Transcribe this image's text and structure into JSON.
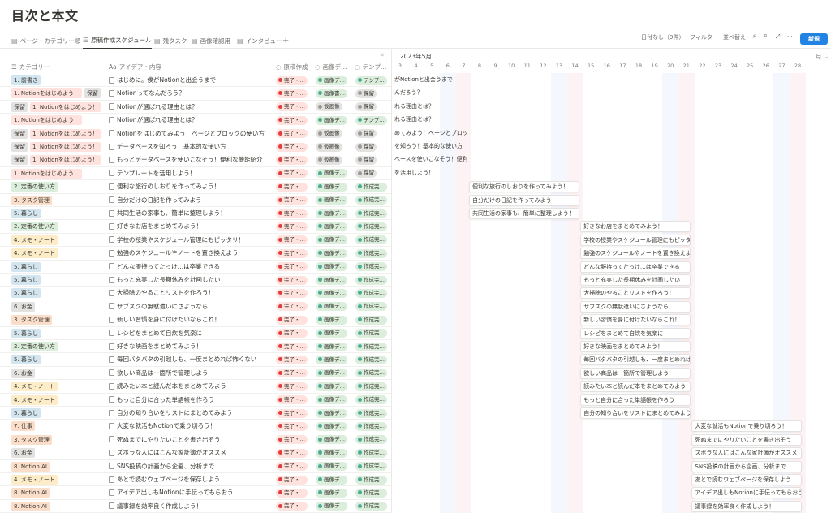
{
  "page_title": "目次と本文",
  "views": [
    {
      "label": "ページ・カテゴリー順",
      "icon": "table-icon"
    },
    {
      "label": "原稿作成スケジュール",
      "icon": "timeline-icon"
    },
    {
      "label": "残タスク",
      "icon": "table-icon"
    },
    {
      "label": "画像確認用",
      "icon": "table-icon"
    },
    {
      "label": "インタビュー",
      "icon": "table-icon"
    }
  ],
  "add_view": "+",
  "toolbar": {
    "no_date": "日付なし（9件）",
    "filter": "フィルター",
    "sort": "並べ替え",
    "automation_icon": "⚡",
    "search_icon": "⌕",
    "expand_icon": "⤢",
    "more_icon": "···",
    "new_button": "新規"
  },
  "collapse_icon": "«",
  "columns": {
    "category": "カテゴリー",
    "idea": "アイデア・内容",
    "draft": "原稿作成",
    "image": "画像デ…",
    "template": "テンプ…"
  },
  "timeline": {
    "month": "2023年5月",
    "mode": "月",
    "days": [
      "3",
      "4",
      "5",
      "6",
      "7",
      "8",
      "9",
      "10",
      "11",
      "12",
      "13",
      "14",
      "15",
      "16",
      "17",
      "18",
      "19",
      "20",
      "21",
      "22",
      "23",
      "24",
      "25",
      "26",
      "27",
      "28"
    ]
  },
  "colors": {
    "cat_1": "#d3e5ef",
    "cat_2": "#dbeddb",
    "cat_3": "#fadec9",
    "cat_4": "#fdecc8",
    "cat_5": "#d3e5ef",
    "cat_6": "#e3e2e0",
    "cat_7": "#fadec9",
    "cat_8": "#fadec9",
    "cat_notion": "#ffe2dd",
    "hold": "#e3e2e0",
    "done_bg": "#ffe2dd",
    "done_dot": "#e03e3e",
    "green_bg": "#dbeddb",
    "green_dot": "#4dab9a",
    "gray_bg": "#e3e2e0",
    "gray_dot": "#9b9a97"
  },
  "rows": [
    {
      "tags": [
        [
          "1. 前書き",
          "cat_1"
        ]
      ],
      "idea": "はじめに。僕がNotionと出会うまで",
      "draft": "完了・…",
      "image": "画像デ…",
      "image_c": "green",
      "tmpl": "テンプ…",
      "bar": "がNotionと出会うまで",
      "bar_day": 0
    },
    {
      "tags": [
        [
          "1. Notionをはじめよう！",
          "cat_notion"
        ],
        [
          "保留",
          "hold"
        ]
      ],
      "idea": "Notionってなんだろう？",
      "draft": "完了・…",
      "image": "画像書…",
      "image_c": "green",
      "tmpl": "保留",
      "bar": "んだろう？",
      "bar_day": 0
    },
    {
      "tags": [
        [
          "保留",
          "hold"
        ],
        [
          "1. Notionをはじめよう！",
          "cat_notion"
        ]
      ],
      "idea": "Notionが選ばれる理由とは？",
      "draft": "完了・…",
      "image": "仮画像",
      "image_c": "gray",
      "tmpl": "保留",
      "bar": "れる理由とは？",
      "bar_day": 0
    },
    {
      "tags": [
        [
          "1. Notionをはじめよう！",
          "cat_notion"
        ]
      ],
      "idea": "Notionが選ばれる理由とは？",
      "draft": "完了・…",
      "image": "画像デ…",
      "image_c": "green",
      "tmpl": "テンプ…",
      "bar": "れる理由とは？",
      "bar_day": 0
    },
    {
      "tags": [
        [
          "保留",
          "hold"
        ],
        [
          "1. Notionをはじめよう！",
          "cat_notion"
        ]
      ],
      "idea": "Notionをはじめてみよう！ページとブロックの使い方",
      "draft": "完了・…",
      "image": "仮画像",
      "image_c": "gray",
      "tmpl": "保留",
      "bar": "めてみよう！ページとブロックの使い方",
      "bar_day": 0
    },
    {
      "tags": [
        [
          "保留",
          "hold"
        ],
        [
          "1. Notionをはじめよう！",
          "cat_notion"
        ]
      ],
      "idea": "データベースを知ろう！基本的な使い方",
      "draft": "完了・…",
      "image": "仮画像",
      "image_c": "gray",
      "tmpl": "保留",
      "bar": "を知ろう！基本的な使い方",
      "bar_day": 0
    },
    {
      "tags": [
        [
          "保留",
          "hold"
        ],
        [
          "1. Notionをはじめよう！",
          "cat_notion"
        ]
      ],
      "idea": "もっとデータベースを使いこなそう！便利な機能紹介",
      "draft": "完了・…",
      "image": "仮画像",
      "image_c": "gray",
      "tmpl": "保留",
      "bar": "ベースを使いこなそう！便利な機能紹介",
      "bar_day": 0
    },
    {
      "tags": [
        [
          "1. Notionをはじめよう！",
          "cat_notion"
        ]
      ],
      "idea": "テンプレートを活用しよう！",
      "draft": "完了・…",
      "image": "画像デ…",
      "image_c": "green",
      "tmpl": "保留",
      "bar": "を活用しよう！",
      "bar_day": 0
    },
    {
      "tags": [
        [
          "2. 定番の使い方",
          "cat_2"
        ]
      ],
      "idea": "便利な旅行のしおりを作ってみよう！",
      "draft": "完了・…",
      "image": "画像デ…",
      "image_c": "green",
      "tmpl": "作成完…",
      "bar": "便利な旅行のしおりを作ってみよう！",
      "bar_day": 5
    },
    {
      "tags": [
        [
          "3. タスク管理",
          "cat_3"
        ]
      ],
      "idea": "自分だけの日記を作ってみよう",
      "draft": "完了・…",
      "image": "画像デ…",
      "image_c": "green",
      "tmpl": "作成完…",
      "bar": "自分だけの日記を作ってみよう",
      "bar_day": 5
    },
    {
      "tags": [
        [
          "5. 暮らし",
          "cat_5"
        ]
      ],
      "idea": "共同生活の家事も、簡単に整理しよう！",
      "draft": "完了・…",
      "image": "画像デ…",
      "image_c": "green",
      "tmpl": "作成完…",
      "bar": "共同生活の家事も、簡単に整理しよう！",
      "bar_day": 5
    },
    {
      "tags": [
        [
          "2. 定番の使い方",
          "cat_2"
        ]
      ],
      "idea": "好きなお店をまとめてみよう！",
      "draft": "完了・…",
      "image": "画像デ…",
      "image_c": "green",
      "tmpl": "作成完…",
      "bar": "好きなお店をまとめてみよう！",
      "bar_day": 12
    },
    {
      "tags": [
        [
          "4. メモ・ノート",
          "cat_4"
        ]
      ],
      "idea": "学校の授業やスケジュール管理にもピッタリ！",
      "draft": "完了・…",
      "image": "画像デ…",
      "image_c": "green",
      "tmpl": "作成完…",
      "bar": "学校の授業やスケジュール管理にもピッタリ！",
      "bar_day": 12
    },
    {
      "tags": [
        [
          "4. メモ・ノート",
          "cat_4"
        ]
      ],
      "idea": "勉強のスケジュールやノートを置き換えよう",
      "draft": "完了・…",
      "image": "画像デ…",
      "image_c": "green",
      "tmpl": "作成完…",
      "bar": "勉強のスケジュールやノートを置き換えよう",
      "bar_day": 12
    },
    {
      "tags": [
        [
          "5. 暮らし",
          "cat_5"
        ]
      ],
      "idea": "どんな服持ってたっけ…は卒業できる",
      "draft": "完了・…",
      "image": "画像デ…",
      "image_c": "green",
      "tmpl": "作成完…",
      "bar": "どんな服持ってたっけ…は卒業できる",
      "bar_day": 12
    },
    {
      "tags": [
        [
          "5. 暮らし",
          "cat_5"
        ]
      ],
      "idea": "もっと充実した長期休みを計画したい",
      "draft": "完了・…",
      "image": "画像デ…",
      "image_c": "green",
      "tmpl": "作成完…",
      "bar": "もっと充実した長期休みを計画したい",
      "bar_day": 12
    },
    {
      "tags": [
        [
          "5. 暮らし",
          "cat_5"
        ]
      ],
      "idea": "大掃除のやることリストを作ろう！",
      "draft": "完了・…",
      "image": "画像デ…",
      "image_c": "green",
      "tmpl": "作成完…",
      "bar": "大掃除のやることリストを作ろう！",
      "bar_day": 12
    },
    {
      "tags": [
        [
          "6. お金",
          "cat_6"
        ]
      ],
      "idea": "サブスクの無駄遣いにさようなら",
      "draft": "完了・…",
      "image": "画像デ…",
      "image_c": "green",
      "tmpl": "作成完…",
      "bar": "サブスクの無駄遣いにさようなら",
      "bar_day": 12
    },
    {
      "tags": [
        [
          "3. タスク管理",
          "cat_3"
        ]
      ],
      "idea": "新しい習慣を身に付けたいならこれ！",
      "draft": "完了・…",
      "image": "画像デ…",
      "image_c": "green",
      "tmpl": "作成完…",
      "bar": "新しい習慣を身に付けたいならこれ！",
      "bar_day": 12
    },
    {
      "tags": [
        [
          "5. 暮らし",
          "cat_5"
        ]
      ],
      "idea": "レシピをまとめて自炊を気楽に",
      "draft": "完了・…",
      "image": "画像デ…",
      "image_c": "green",
      "tmpl": "作成完…",
      "bar": "レシピをまとめて自炊を気楽に",
      "bar_day": 12
    },
    {
      "tags": [
        [
          "2. 定番の使い方",
          "cat_2"
        ]
      ],
      "idea": "好きな映画をまとめてみよう！",
      "draft": "完了・…",
      "image": "画像デ…",
      "image_c": "green",
      "tmpl": "作成完…",
      "bar": "好きな映画をまとめてみよう！",
      "bar_day": 12
    },
    {
      "tags": [
        [
          "5. 暮らし",
          "cat_5"
        ]
      ],
      "idea": "毎回バタバタの引越しも、一度まとめれば怖くない",
      "draft": "完了・…",
      "image": "画像デ…",
      "image_c": "green",
      "tmpl": "作成完…",
      "bar": "毎回バタバタの引越しも、一度まとめれば怖くない",
      "bar_day": 12
    },
    {
      "tags": [
        [
          "6. お金",
          "cat_6"
        ]
      ],
      "idea": "欲しい商品は一箇所で管理しよう",
      "draft": "完了・…",
      "image": "画像デ…",
      "image_c": "green",
      "tmpl": "作成完…",
      "bar": "欲しい商品は一箇所で管理しよう",
      "bar_day": 12
    },
    {
      "tags": [
        [
          "4. メモ・ノート",
          "cat_4"
        ]
      ],
      "idea": "読みたい本と読んだ本をまとめてみよう",
      "draft": "完了・…",
      "image": "画像デ…",
      "image_c": "green",
      "tmpl": "作成完…",
      "bar": "読みたい本と読んだ本をまとめてみよう",
      "bar_day": 12
    },
    {
      "tags": [
        [
          "4. メモ・ノート",
          "cat_4"
        ]
      ],
      "idea": "もっと自分に合った単語帳を作ろう",
      "draft": "完了・…",
      "image": "画像デ…",
      "image_c": "green",
      "tmpl": "作成完…",
      "bar": "もっと自分に合った単語帳を作ろう",
      "bar_day": 12
    },
    {
      "tags": [
        [
          "5. 暮らし",
          "cat_5"
        ]
      ],
      "idea": "自分の知り合いをリストにまとめてみよう",
      "draft": "完了・…",
      "image": "画像デ…",
      "image_c": "green",
      "tmpl": "作成完…",
      "bar": "自分の知り合いをリストにまとめてみよう",
      "bar_day": 12
    },
    {
      "tags": [
        [
          "7. 仕事",
          "cat_7"
        ]
      ],
      "idea": "大変な就活もNotionで乗り切ろう！",
      "draft": "完了・…",
      "image": "画像デ…",
      "image_c": "green",
      "tmpl": "作成完…",
      "bar": "大変な就活もNotionで乗り切ろう！",
      "bar_day": 19
    },
    {
      "tags": [
        [
          "3. タスク管理",
          "cat_3"
        ]
      ],
      "idea": "死ぬまでにやりたいことを書き出そう",
      "draft": "完了・…",
      "image": "画像デ…",
      "image_c": "green",
      "tmpl": "作成完…",
      "bar": "死ぬまでにやりたいことを書き出そう",
      "bar_day": 19
    },
    {
      "tags": [
        [
          "6. お金",
          "cat_6"
        ]
      ],
      "idea": "ズボラな人にはこんな家計簿がオススメ",
      "draft": "完了・…",
      "image": "画像デ…",
      "image_c": "green",
      "tmpl": "作成完…",
      "bar": "ズボラな人にはこんな家計簿がオススメ",
      "bar_day": 19
    },
    {
      "tags": [
        [
          "8. Notion AI",
          "cat_8"
        ]
      ],
      "idea": "SNS投稿の計画から企画、分析まで",
      "draft": "完了・…",
      "image": "画像デ…",
      "image_c": "green",
      "tmpl": "作成完…",
      "bar": "SNS投稿の計画から企画、分析まで",
      "bar_day": 19
    },
    {
      "tags": [
        [
          "4. メモ・ノート",
          "cat_4"
        ]
      ],
      "idea": "あとで読むウェブページを保存しよう",
      "draft": "完了・…",
      "image": "画像デ…",
      "image_c": "green",
      "tmpl": "作成完…",
      "bar": "あとで読むウェブページを保存しよう",
      "bar_day": 19
    },
    {
      "tags": [
        [
          "8. Notion AI",
          "cat_8"
        ]
      ],
      "idea": "アイデア出しもNotionに手伝ってもらおう",
      "draft": "完了・…",
      "image": "画像デ…",
      "image_c": "green",
      "tmpl": "作成完…",
      "bar": "アイデア出しもNotionに手伝ってもらおう",
      "bar_day": 19
    },
    {
      "tags": [
        [
          "8. Notion AI",
          "cat_8"
        ]
      ],
      "idea": "議事録を効率良く作成しよう！",
      "draft": "完了・…",
      "image": "画像デ…",
      "image_c": "green",
      "tmpl": "作成完…",
      "bar": "議事録を効率良く作成しよう！",
      "bar_day": 19
    }
  ]
}
